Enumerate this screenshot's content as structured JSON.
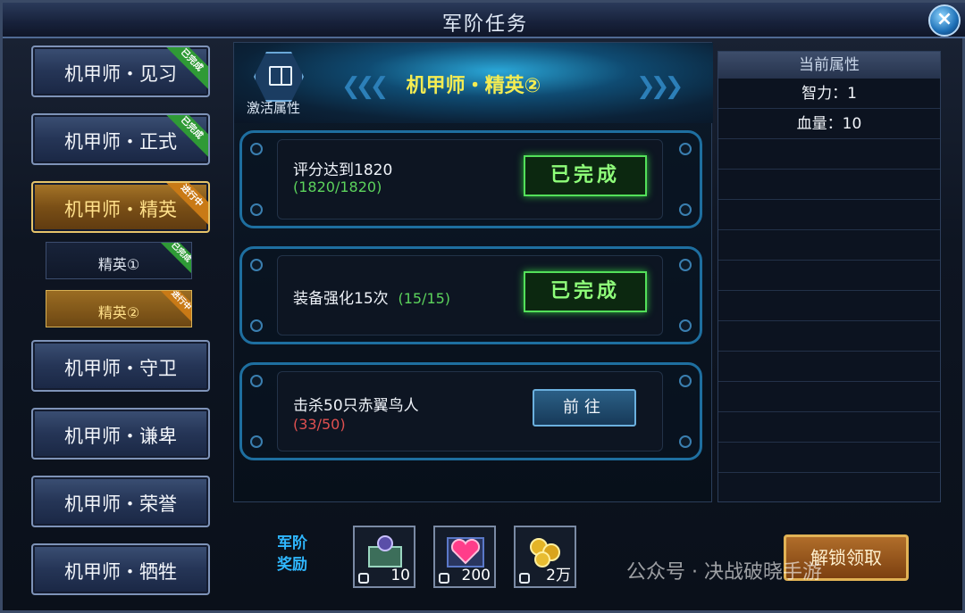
{
  "window": {
    "title": "军阶任务",
    "close_icon": "×"
  },
  "ranks": [
    {
      "label": "机甲师・见习",
      "status": "已完成"
    },
    {
      "label": "机甲师・正式",
      "status": "已完成"
    },
    {
      "label": "机甲师・精英",
      "status": "进行中"
    },
    {
      "label": "机甲师・守卫"
    },
    {
      "label": "机甲师・谦卑"
    },
    {
      "label": "机甲师・荣誉"
    },
    {
      "label": "机甲师・牺牲"
    }
  ],
  "subranks": [
    {
      "label": "精英①",
      "status": "已完成"
    },
    {
      "label": "精英②",
      "status": "进行中"
    }
  ],
  "center": {
    "activate_label": "激活属性",
    "rank_title": "机甲师・精英②",
    "tasks": [
      {
        "desc": "评分达到1820",
        "progress": "(1820/1820)",
        "button": "已完成"
      },
      {
        "desc": "装备强化15次",
        "progress": "(15/15)",
        "button": "已完成"
      },
      {
        "desc": "击杀50只赤翼鸟人",
        "progress": "(33/50)",
        "button": "前往"
      }
    ]
  },
  "attributes": {
    "header": "当前属性",
    "rows": [
      "智力：1",
      "血量：10",
      "",
      "",
      "",
      "",
      "",
      "",
      "",
      "",
      "",
      "",
      ""
    ]
  },
  "rewards": {
    "label_line1": "军阶",
    "label_line2": "奖励",
    "items": [
      {
        "icon": "chest-icon",
        "qty": "10"
      },
      {
        "icon": "heart-gem-icon",
        "qty": "200"
      },
      {
        "icon": "gold-coins-icon",
        "qty": "2万"
      }
    ],
    "unlock_button": "解锁领取"
  },
  "watermark": "公众号 · 决战破晓手游",
  "colors": {
    "accent": "#2fb7ff",
    "done_green": "#53e05a",
    "gold": "#e1b255",
    "rank_title": "#f4ec52"
  }
}
